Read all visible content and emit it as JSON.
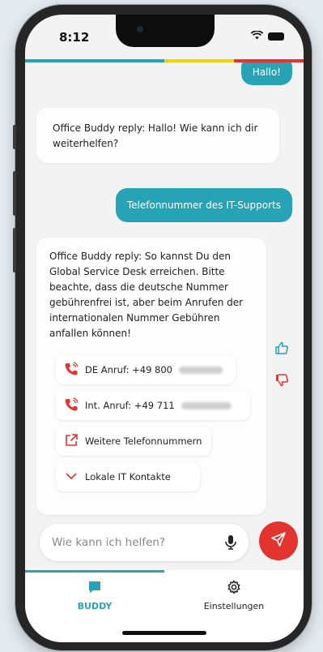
{
  "status_bar": {
    "time": "8:12"
  },
  "colors": {
    "accent": "#26a3b4",
    "danger": "#e3342f",
    "brand_bar": [
      "#26a3b4",
      "#26a3b4",
      "#f2d20c",
      "#e3342f"
    ]
  },
  "chat": {
    "messages": [
      {
        "role": "user",
        "text": "Hallo!"
      },
      {
        "role": "bot",
        "text": "Office Buddy reply: Hallo! Wie kann ich dir weiterhelfen?"
      },
      {
        "role": "user",
        "text": "Telefonnummer des IT-Supports"
      },
      {
        "role": "bot",
        "text": "Office Buddy reply: So kannst Du den Global Service Desk erreichen. Bitte beachte, dass die deutsche Nummer gebührenfrei ist, aber beim Anrufen der internationalen Nummer Gebühren anfallen können!"
      }
    ],
    "actions": [
      {
        "icon": "phone-icon",
        "label": "DE Anruf: +49 800"
      },
      {
        "icon": "phone-icon",
        "label": "Int. Anruf: +49 711"
      },
      {
        "icon": "external-link-icon",
        "label": "Weitere Telefonnummern"
      },
      {
        "icon": "chevron-down-icon",
        "label": "Lokale IT Kontakte"
      }
    ]
  },
  "composer": {
    "placeholder": "Wie kann ich helfen?"
  },
  "tabs": [
    {
      "label": "BUDDY",
      "icon": "chat-icon",
      "active": true
    },
    {
      "label": "Einstellungen",
      "icon": "gear-icon",
      "active": false
    }
  ]
}
